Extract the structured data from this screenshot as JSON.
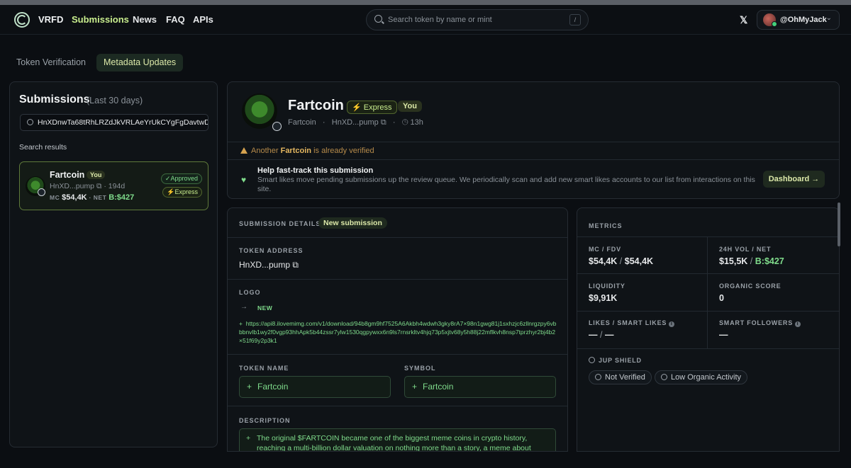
{
  "nav": {
    "brand": "VRFD",
    "links": [
      "Submissions",
      "News",
      "FAQ",
      "APIs"
    ],
    "search_placeholder": "Search token by name or mint",
    "search_shortcut": "/",
    "x_icon": "𝕏",
    "username": "@OhMyJack"
  },
  "tabs": [
    "Token Verification",
    "Metadata Updates"
  ],
  "left": {
    "title": "Submissions",
    "subtitle": "(Last 30 days)",
    "search_value": "HnXDnwTa68tRhLRZdJkVRLAeYrUkCYgFgDavtwD",
    "results_label": "Search results",
    "result": {
      "name": "Fartcoin",
      "you": "You",
      "address": "HnXD...pump",
      "age": "194d",
      "mc_label": "MC",
      "mc_value": "$54,4K",
      "net_label": "NET",
      "net_value": "B:$427",
      "status": "Approved",
      "express": "Express"
    }
  },
  "header": {
    "name": "Fartcoin",
    "express": "Express",
    "you": "You",
    "symbol": "Fartcoin",
    "address": "HnXD...pump",
    "age": "13h",
    "warning_prefix": "Another",
    "warning_token": "Fartcoin",
    "warning_suffix": "is already verified",
    "fasttrack_title": "Help fast-track this submission",
    "fasttrack_desc": "Smart likes move pending submissions up the review queue. We periodically scan and add new smart likes accounts to our list from interactions on this site.",
    "dashboard_label": "Dashboard"
  },
  "details": {
    "section_label": "SUBMISSION DETAILS",
    "badge": "New submission",
    "token_address_label": "TOKEN ADDRESS",
    "token_address": "HnXD...pump",
    "logo_label": "LOGO",
    "logo_new": "NEW",
    "logo_url": "https://api8.ilovemimg.com/v1/download/94b8gm9hf7525A6Akbh4wdwh3gky8rA7×98n1gwg81j1sxhzjc6zllnrgzpy6vbbbnvlb1wy2f0vgp93hhApk5b44zssr7ylw1530qgpywxx6n9ls7rnsrkltv4hjq73p5xjtv68y5h88j22mflkvh8nsp7tprzhyr2bj4b2×51f69y2p3k1",
    "token_name_label": "TOKEN NAME",
    "token_name": "Fartcoin",
    "symbol_label": "SYMBOL",
    "symbol": "Fartcoin",
    "description_label": "DESCRIPTION",
    "description": "The original $FARTCOIN became one of the biggest meme coins in crypto history, reaching a multi-billion dollar valuation on nothing more than a story, a meme about saving the"
  },
  "metrics": {
    "section_label": "METRICS",
    "mc_fdv_label": "MC / FDV",
    "mc": "$54,4K",
    "fdv": "$54,4K",
    "vol_label": "24H VOL / NET",
    "vol": "$15,5K",
    "net": "B:$427",
    "liquidity_label": "LIQUIDITY",
    "liquidity": "$9,91K",
    "organic_label": "ORGANIC SCORE",
    "organic": "0",
    "likes_label": "LIKES / SMART LIKES",
    "likes": "—",
    "smart_likes": "—",
    "followers_label": "SMART FOLLOWERS",
    "followers": "—",
    "shield_label": "JUP SHIELD",
    "shield_pills": [
      "Not Verified",
      "Low Organic Activity"
    ]
  }
}
